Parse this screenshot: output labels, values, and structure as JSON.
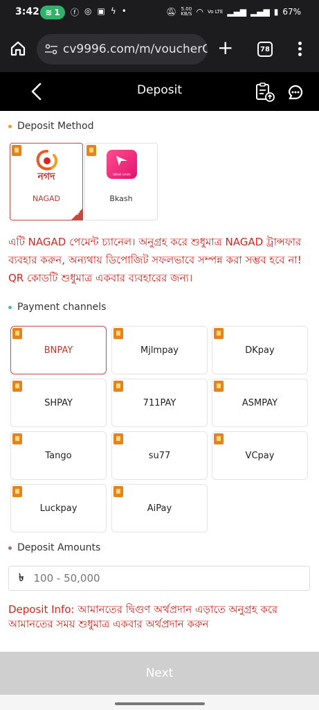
{
  "status_bar": {
    "time": "3:42",
    "hotspot_count": "1",
    "network_speed": "5.00",
    "network_unit": "KB/S",
    "volte": "Vo LTE",
    "battery": "67%"
  },
  "browser": {
    "url": "cv9996.com/m/voucherC",
    "tab_count": "78"
  },
  "header": {
    "title": "Deposit"
  },
  "deposit_method": {
    "title": "Deposit Method",
    "methods": [
      {
        "label": "NAGAD",
        "logo_text": "নগদ"
      },
      {
        "label": "Bkash",
        "logo_text": "bKash Limits"
      }
    ]
  },
  "notice": "এটি NAGAD পেমেন্ট চ্যানেল। অনুগ্রহ করে শুধুমাত্র NAGAD ট্রান্সফার ব্যবহার করুন, অন্যথায় ডিপোজিট সফলভাবে সম্পন্ন করা সম্ভব হবে না! QR কোডটি শুধুমাত্র একবার ব্যবহারের জন্য।",
  "payment_channels": {
    "title": "Payment channels",
    "items": [
      "BNPAY",
      "Mjlmpay",
      "DKpay",
      "SHPAY",
      "711PAY",
      "ASMPAY",
      "Tango",
      "su77",
      "VCpay",
      "Luckpay",
      "AiPay"
    ]
  },
  "deposit_amounts": {
    "title": "Deposit Amounts",
    "currency": "৳",
    "placeholder": "100 - 50,000"
  },
  "deposit_info": {
    "label": "Deposit Info:",
    "text": "আমানতের দ্বিগুণ অর্থপ্রদান এড়াতে অনুগ্রহ করে আমানতের সময় শুধুমাত্র একবার অর্থপ্রদান করুন"
  },
  "next_button": "Next",
  "colors": {
    "accent_red": "#d8241c",
    "selected_border": "#c7483f",
    "tag_orange": "#e8821c",
    "dot_orange": "#f0a020",
    "dot_teal": "#5fb3a8",
    "dot_mauve": "#a0707a"
  }
}
